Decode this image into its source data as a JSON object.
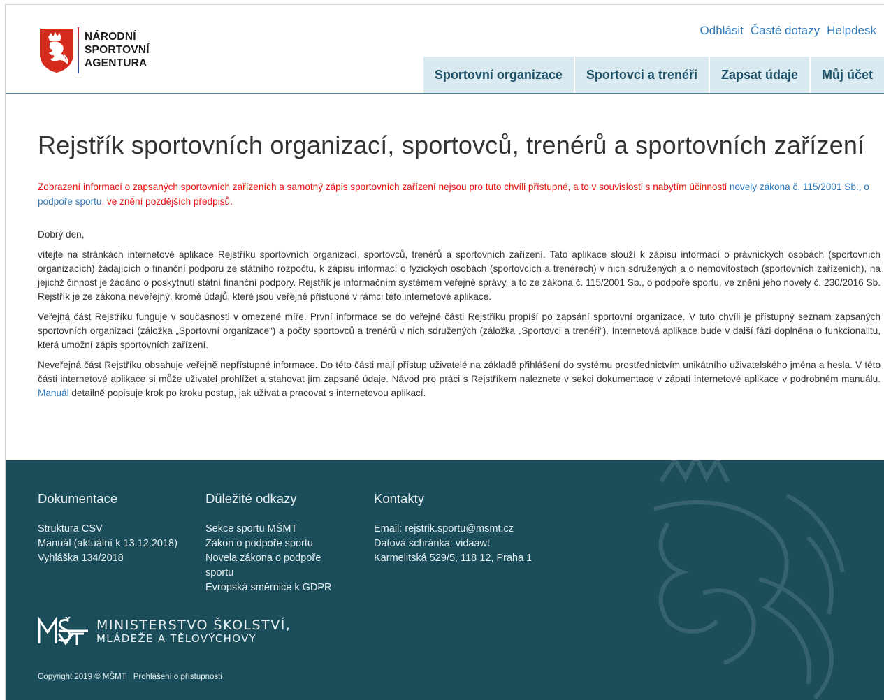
{
  "header": {
    "logo": {
      "line1": "NÁRODNÍ",
      "line2": "SPORTOVNÍ",
      "line3": "AGENTURA"
    },
    "top_links": [
      "Odhlásit",
      "Časté dotazy",
      "Helpdesk"
    ],
    "nav": [
      "Sportovní organizace",
      "Sportovci a trenéři",
      "Zapsat údaje",
      "Můj účet"
    ]
  },
  "main": {
    "title": "Rejstřík sportovních organizací, sportovců, trenérů a sportovních zařízení",
    "notice": {
      "before": "Zobrazení informací o zapsaných sportovních zařízeních a samotný zápis sportovních zařízení nejsou pro tuto chvíli přístupné, a to v souvislosti s nabytím účinnosti ",
      "link": "novely zákona č. 115/2001 Sb., o podpoře sportu",
      "after": ", ve znění pozdějších předpisů."
    },
    "greeting": "Dobrý den,",
    "p1": "vítejte na stránkách internetové aplikace Rejstříku sportovních organizací, sportovců, trenérů a sportovních zařízení. Tato aplikace slouží k zápisu informací o právnických osobách (sportovních organizacích) žádajících o finanční podporu ze státního rozpočtu, k zápisu informací o fyzických osobách (sportovcích a trenérech) v nich sdružených a o nemovitostech (sportovních zařízeních), na jejichž činnost je žádáno o poskytnutí státní finanční podpory. Rejstřík je informačním systémem veřejné správy, a to ze zákona č. 115/2001 Sb., o podpoře sportu, ve znění jeho novely č. 230/2016 Sb. Rejstřík je ze zákona neveřejný, kromě údajů, které jsou veřejně přístupné v rámci této internetové aplikace.",
    "p2": "Veřejná část Rejstříku funguje v současnosti v omezené míře. První informace se do veřejné části Rejstříku propíší po zapsání sportovní organizace. V tuto chvíli je přístupný seznam zapsaných sportovních organizací (záložka „Sportovní organizace“) a počty sportovců a trenérů v nich sdružených (záložka „Sportovci a trenéři“). Internetová aplikace bude v další fázi doplněna o funkcionalitu, která umožní zápis sportovních zařízení.",
    "p3": {
      "before": "Neveřejná část Rejstříku obsahuje veřejně nepřístupné informace. Do této části mají přístup uživatelé na základě přihlášení do systému prostřednictvím unikátního uživatelského jména a hesla. V této části internetové aplikace si může uživatel prohlížet a stahovat jím zapsané údaje. Návod pro práci s Rejstříkem naleznete v sekci dokumentace v zápatí internetové aplikace v podrobném manuálu. ",
      "link": "Manuál",
      "after": " detailně popisuje krok po kroku postup, jak užívat a pracovat s internetovou aplikací."
    }
  },
  "footer": {
    "col1": {
      "title": "Dokumentace",
      "items": [
        "Struktura CSV",
        "Manuál (aktuální k 13.12.2018)",
        "Vyhláška 134/2018"
      ]
    },
    "col2": {
      "title": "Důležité odkazy",
      "items": [
        "Sekce sportu MŠMT",
        "Zákon o podpoře sportu",
        "Novela zákona o podpoře sportu",
        "Evropská směrnice k GDPR"
      ]
    },
    "col3": {
      "title": "Kontakty",
      "items": [
        "Email: rejstrik.sportu@msmt.cz",
        "Datová schránka: vidaawt",
        "Karmelitská 529/5, 118 12, Praha 1"
      ]
    },
    "ministry": {
      "line1": "MINISTERSTVO ŠKOLSTVÍ,",
      "line2": "MLÁDEŽE A TĚLOVÝCHOVY"
    },
    "copyright": "Copyright 2019 © MŠMT",
    "accessibility": "Prohlášení o přístupnosti"
  },
  "colors": {
    "nav_bg": "#d9ebf1",
    "footer_bg": "#1b4d5b",
    "link": "#2f78b8",
    "notice": "#e8110f"
  },
  "icons": {
    "logo": "czech-lion-emblem",
    "ministry": "msmt-logo"
  }
}
